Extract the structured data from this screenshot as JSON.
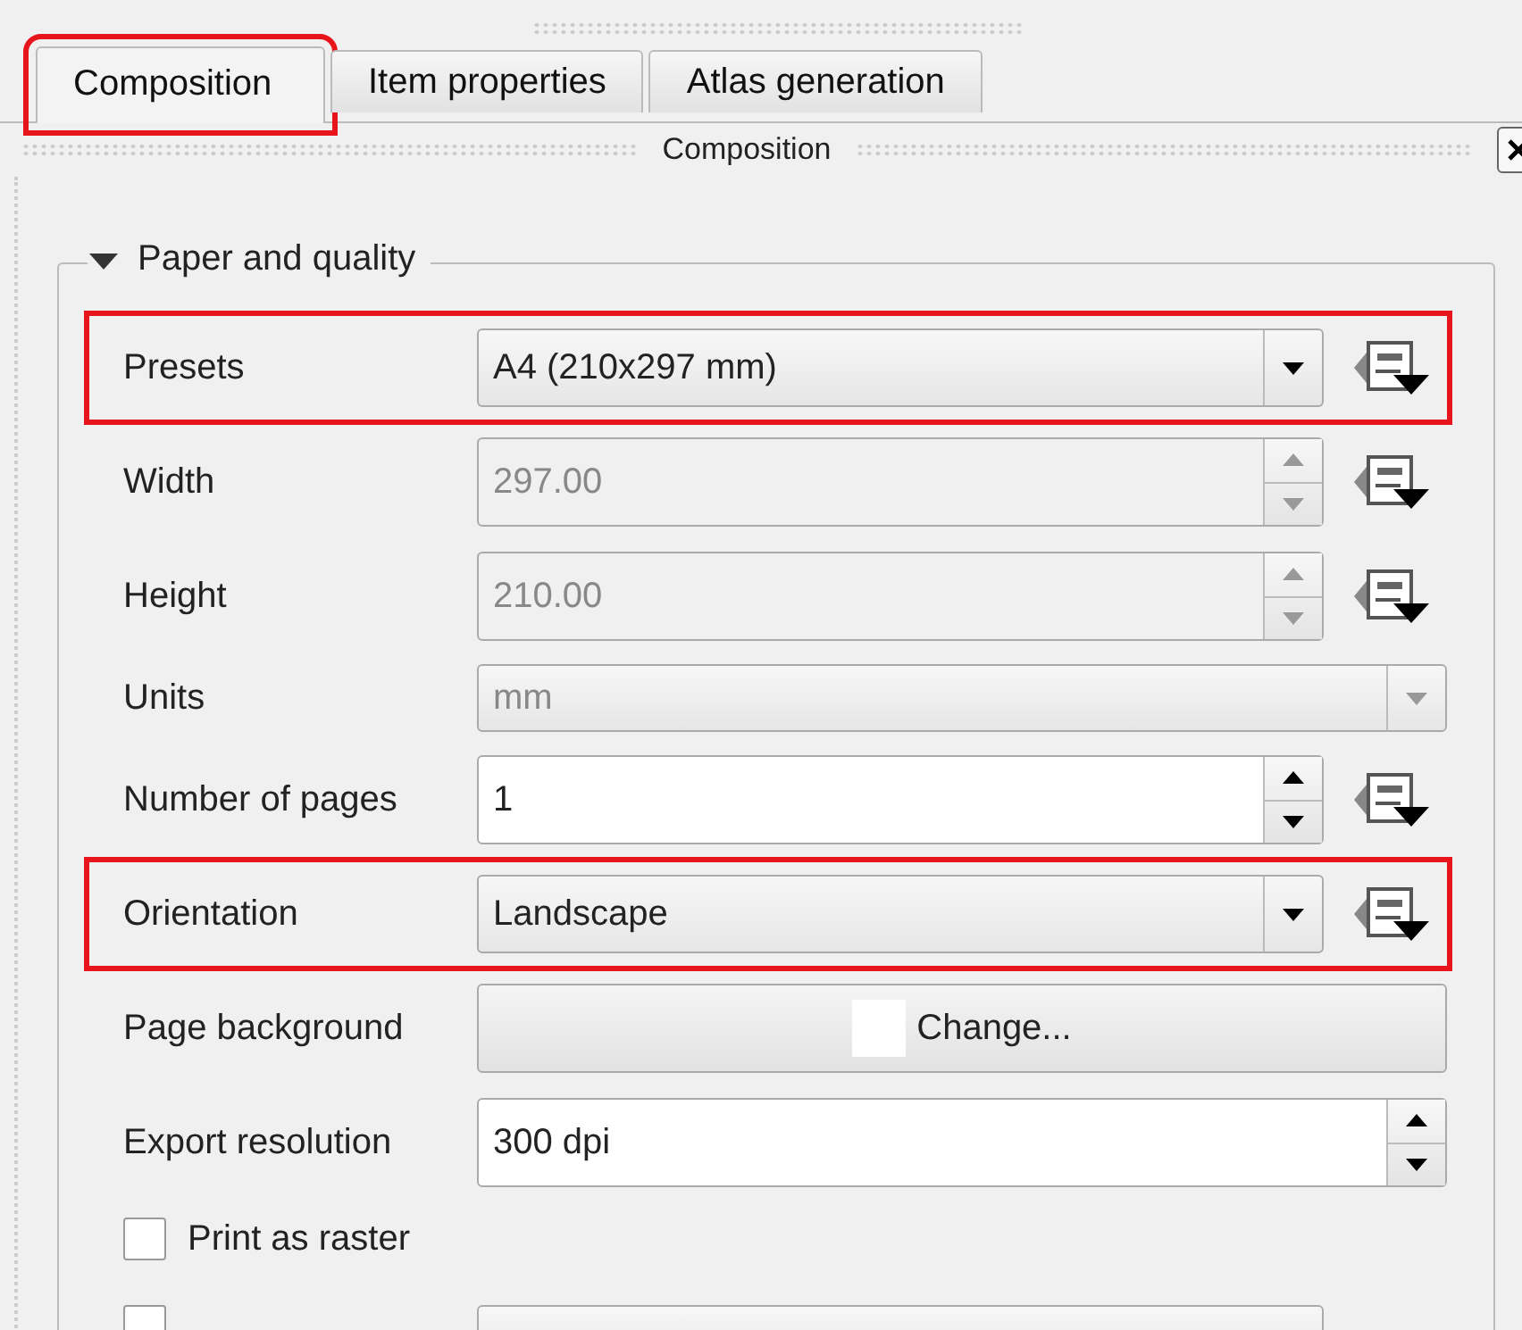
{
  "tabs": [
    {
      "label": "Composition",
      "selected": true,
      "highlighted": true
    },
    {
      "label": "Item properties",
      "selected": false,
      "highlighted": false
    },
    {
      "label": "Atlas generation",
      "selected": false,
      "highlighted": false
    }
  ],
  "dock": {
    "title": "Composition"
  },
  "group": {
    "title": "Paper and quality",
    "expanded": true,
    "rows": [
      {
        "kind": "combo",
        "label": "Presets",
        "value": "A4 (210x297 mm)",
        "disabled": false,
        "override": true,
        "highlighted": true
      },
      {
        "kind": "spin",
        "label": "Width",
        "value": "297.00",
        "disabled": true,
        "override": true,
        "highlighted": false
      },
      {
        "kind": "spin",
        "label": "Height",
        "value": "210.00",
        "disabled": true,
        "override": true,
        "highlighted": false
      },
      {
        "kind": "combo",
        "label": "Units",
        "value": "mm",
        "disabled": true,
        "override": false,
        "highlighted": false
      },
      {
        "kind": "spin",
        "label": "Number of pages",
        "value": "1",
        "disabled": false,
        "override": true,
        "highlighted": false
      },
      {
        "kind": "combo",
        "label": "Orientation",
        "value": "Landscape",
        "disabled": false,
        "override": true,
        "highlighted": true
      },
      {
        "kind": "button",
        "label": "Page background",
        "value": "Change...",
        "disabled": false,
        "override": false,
        "highlighted": false
      },
      {
        "kind": "spin",
        "label": "Export resolution",
        "value": "300 dpi",
        "disabled": false,
        "override": false,
        "highlighted": false
      },
      {
        "kind": "checkbox",
        "label": "Print as raster",
        "checked": false
      },
      {
        "kind": "checkbox_combo",
        "checked": false
      }
    ]
  }
}
